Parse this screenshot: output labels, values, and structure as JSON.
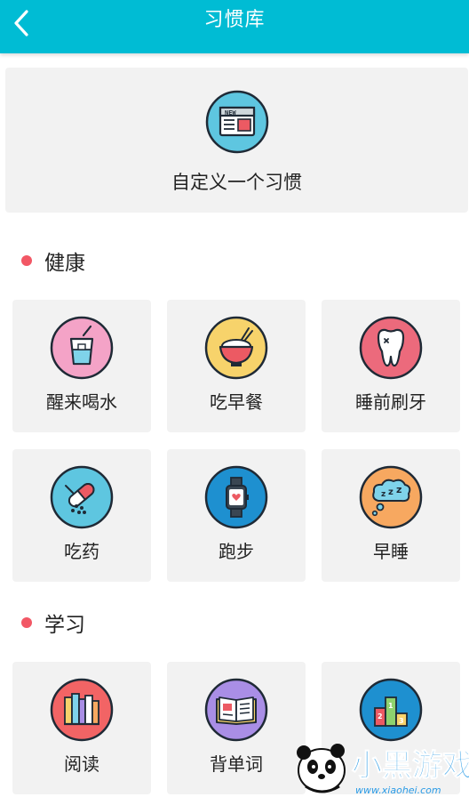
{
  "header": {
    "title": "习惯库",
    "background": "#00bcd4"
  },
  "custom": {
    "label": "自定义一个习惯",
    "icon": "news-icon",
    "icon_color": "#5ec6e0"
  },
  "sections": [
    {
      "title": "健康",
      "items": [
        {
          "label": "醒来喝水",
          "icon": "drink-cup-icon",
          "color": "#f4a3c7"
        },
        {
          "label": "吃早餐",
          "icon": "rice-bowl-icon",
          "color": "#f7d36b"
        },
        {
          "label": "睡前刷牙",
          "icon": "tooth-icon",
          "color": "#ec6a7c"
        },
        {
          "label": "吃药",
          "icon": "pill-icon",
          "color": "#5ec6e0"
        },
        {
          "label": "跑步",
          "icon": "watch-icon",
          "color": "#1e90d0"
        },
        {
          "label": "早睡",
          "icon": "sleep-icon",
          "color": "#f7a860"
        }
      ]
    },
    {
      "title": "学习",
      "items": [
        {
          "label": "阅读",
          "icon": "books-icon",
          "color": "#f26465"
        },
        {
          "label": "背单词",
          "icon": "open-book-icon",
          "color": "#a98ee6"
        },
        {
          "label": "",
          "icon": "podium-icon",
          "color": "#1e90d0"
        }
      ]
    }
  ],
  "accent_dot_color": "#f25765",
  "watermark": {
    "brand": "小黑游戏",
    "url": "www.xiaohei.com"
  }
}
